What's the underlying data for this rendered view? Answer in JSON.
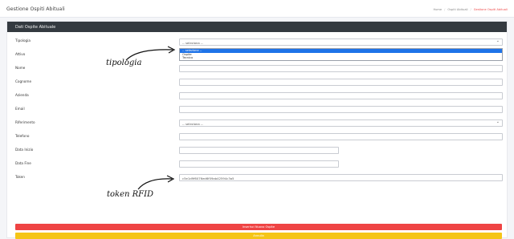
{
  "header": {
    "title": "Gestione Ospiti Abituali",
    "breadcrumb": [
      "Home",
      "Ospiti Abituali",
      "Gestione Ospiti Abituali"
    ]
  },
  "card": {
    "title": "Dati Ospite Abituale"
  },
  "form": {
    "tipologia": {
      "label": "Tipologia",
      "value": "-- seleziona --",
      "options": [
        "-- seleziona --",
        "Ospite",
        "Tecnico"
      ]
    },
    "attivo": {
      "label": "Attivo"
    },
    "nome": {
      "label": "Nome",
      "value": ""
    },
    "cognome": {
      "label": "Cognome",
      "value": ""
    },
    "azienda": {
      "label": "Azienda",
      "value": ""
    },
    "email": {
      "label": "Email",
      "value": ""
    },
    "riferimento": {
      "label": "Riferimento",
      "value": "-- seleziona --"
    },
    "telefono": {
      "label": "Telefono",
      "value": ""
    },
    "data_inizio": {
      "label": "Data Inizio",
      "value": ""
    },
    "data_fine": {
      "label": "Data Fine",
      "value": ""
    },
    "token": {
      "label": "Token",
      "value": "c5e1d9f6076ed6f09ab42594c3a5"
    }
  },
  "annotations": {
    "tipologia": "tipologia",
    "token": "token RFID"
  },
  "buttons": {
    "save": "Inserisci Nuovo Ospite",
    "cancel": "Annulla"
  },
  "colors": {
    "header_bg": "#343a40",
    "save_bg": "#ef4444",
    "cancel_bg": "#f5c518",
    "breadcrumb_active": "#ef4b4b"
  }
}
